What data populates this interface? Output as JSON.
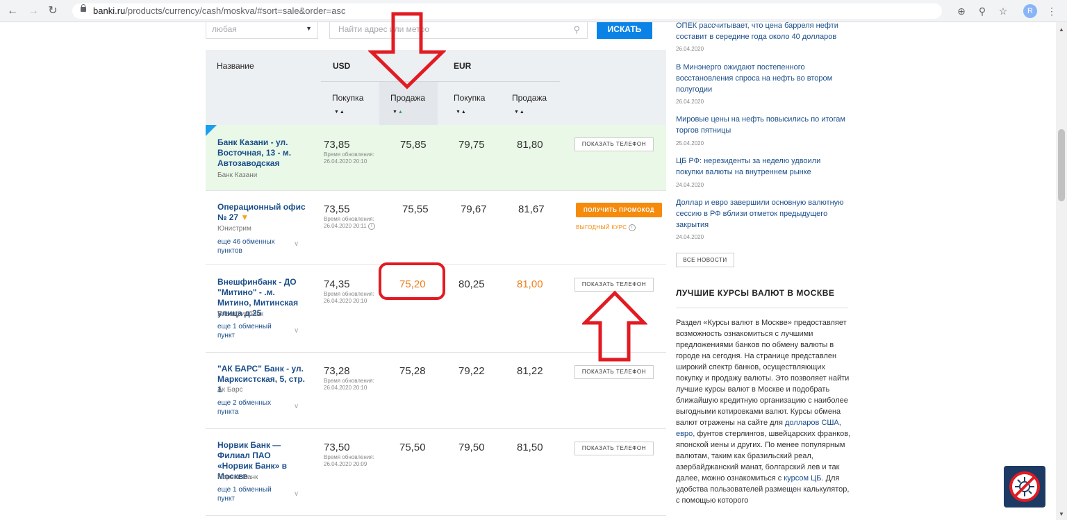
{
  "browser": {
    "url_host": "banki.ru",
    "url_path": "/products/currency/cash/moskva/#sort=sale&order=asc",
    "avatar_letter": "R"
  },
  "search": {
    "select_value": "любая",
    "input_placeholder": "Найти адрес или метро",
    "button_label": "ИСКАТЬ"
  },
  "table": {
    "col_name": "Название",
    "usd_label": "USD",
    "eur_label": "EUR",
    "buy_label": "Покупка",
    "sell_label": "Продажа",
    "update_label": "Время обновления:",
    "show_phone": "ПОКАЗАТЬ ТЕЛЕФОН",
    "promo_label": "ПОЛУЧИТЬ ПРОМОКОД",
    "benefit_label": "ВЫГОДНЫЙ КУРС",
    "rows": [
      {
        "name": "Банк Казани - ул. Восточная, 13 - м. Автозаводская",
        "bank": "Банк Казани",
        "more": "",
        "usd_buy": "73,85",
        "usd_sell": "75,85",
        "eur_buy": "79,75",
        "eur_sell": "81,80",
        "updated": "26.04.2020 20:10"
      },
      {
        "name": "Операционный офис № 27",
        "bank": "Юнистрим",
        "more": "еще 46 обменных пунктов",
        "usd_buy": "73,55",
        "usd_sell": "75,55",
        "eur_buy": "79,67",
        "eur_sell": "81,67",
        "updated": "26.04.2020 20:11"
      },
      {
        "name": "Внешфинбанк - ДО \"Митино\" - .м. Митино, Митинская улица д.25",
        "bank": "Внешфинбанк",
        "more": "еще 1 обменный пункт",
        "usd_buy": "74,35",
        "usd_sell": "75,20",
        "eur_buy": "80,25",
        "eur_sell": "81,00",
        "updated": "26.04.2020 20:10"
      },
      {
        "name": "\"АК БАРС\" Банк - ул. Марксистская, 5, стр. 1",
        "bank": "Ак Барс",
        "more": "еще 2 обменных пункта",
        "usd_buy": "73,28",
        "usd_sell": "75,28",
        "eur_buy": "79,22",
        "eur_sell": "81,22",
        "updated": "26.04.2020 20:10"
      },
      {
        "name": "Норвик Банк — Филиал ПАО «Норвик Банк» в Москве",
        "bank": "Норвик Банк",
        "more": "еще 1 обменный пункт",
        "usd_buy": "73,50",
        "usd_sell": "75,50",
        "eur_buy": "79,50",
        "eur_sell": "81,50",
        "updated": "26.04.2020 20:09"
      }
    ]
  },
  "sidebar": {
    "news": [
      {
        "title": "ОПЕК рассчитывает, что цена барреля нефти составит в середине года около 40 долларов",
        "date": "26.04.2020"
      },
      {
        "title": "В Минэнерго ожидают постепенного восстановления спроса на нефть во втором полугодии",
        "date": "26.04.2020"
      },
      {
        "title": "Мировые цены на нефть повысились по итогам торгов пятницы",
        "date": "25.04.2020"
      },
      {
        "title": "ЦБ РФ: нерезиденты за неделю удвоили покупки валюты на внутреннем рынке",
        "date": "24.04.2020"
      },
      {
        "title": "Доллар и евро завершили основную валютную сессию в РФ вблизи отметок предыдущего закрытия",
        "date": "24.04.2020"
      }
    ],
    "all_news": "ВСЕ НОВОСТИ",
    "section_title": "ЛУЧШИЕ КУРСЫ ВАЛЮТ В МОСКВЕ",
    "text_1": "Раздел «Курсы валют в  Москве» предоставляет возможность ознакомиться с лучшими предложениями банков по обмену валюты в городе на сегодня. На странице представлен широкий спектр банков, осуществляющих покупку и продажу валюты. Это позволяет найти лучшие курсы валют в Москве и подобрать ближайшую кредитную организацию с наиболее выгодными котировками валют. Курсы обмена валют отражены на сайте для ",
    "link_usd": "долларов США",
    "sep_1": ", ",
    "link_eur": "евро",
    "text_2": ", фунтов стерлингов, швейцарских франков, японской иены и других. По менее популярным валютам, таким как бразильский реал, азербайджанский манат, болгарский лев и так далее, можно ознакомиться с ",
    "link_cb": "курсом ЦБ",
    "text_3": ".  Для удобства пользователей размещен калькулятор, с помощью которого"
  },
  "colors": {
    "accent": "#0b83e6",
    "highlight_row": "#e9f8e7",
    "annotation": "#e21b23",
    "promo": "#f58a0b"
  }
}
